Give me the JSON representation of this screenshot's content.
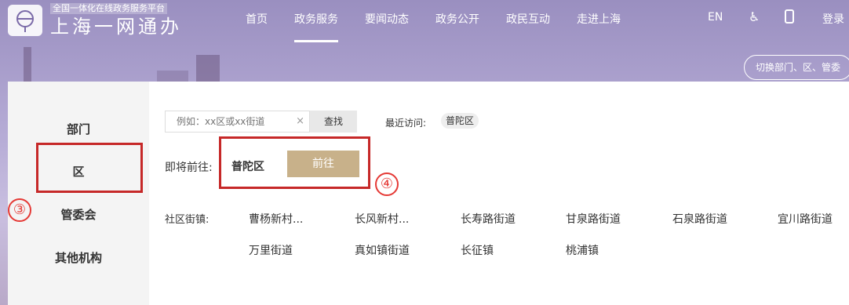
{
  "header": {
    "platform_sub": "全国一体化在线政务服务平台",
    "platform_name": "上海一网通办",
    "nav": [
      {
        "label": "首页",
        "active": false
      },
      {
        "label": "政务服务",
        "active": true
      },
      {
        "label": "要闻动态",
        "active": false
      },
      {
        "label": "政务公开",
        "active": false
      },
      {
        "label": "政民互动",
        "active": false
      },
      {
        "label": "走进上海",
        "active": false
      }
    ],
    "lang": "EN",
    "accessibility_icon": "accessibility-icon",
    "phone_icon": "mobile-phone-icon",
    "login": "登录",
    "switch": "切换部门、区、管委"
  },
  "sidebar": {
    "items": [
      {
        "label": "部门"
      },
      {
        "label": "区"
      },
      {
        "label": "管委会"
      },
      {
        "label": "其他机构"
      }
    ]
  },
  "search": {
    "placeholder": "例如：xx区或xx街道",
    "clear": "×",
    "button": "查找"
  },
  "recent": {
    "label": "最近访问:",
    "tag": "普陀区"
  },
  "goto": {
    "label": "即将前往:",
    "value": "普陀区",
    "button": "前往"
  },
  "streets": {
    "label": "社区街镇:",
    "items": [
      "曹杨新村...",
      "长风新村...",
      "长寿路街道",
      "甘泉路街道",
      "石泉路街道",
      "宜川路街道",
      "万里街道",
      "真如镇街道",
      "长征镇",
      "桃浦镇"
    ]
  },
  "annotations": {
    "marker3": "③",
    "marker4": "④"
  },
  "colors": {
    "accent": "#c8b18a",
    "highlight": "#c62828"
  }
}
